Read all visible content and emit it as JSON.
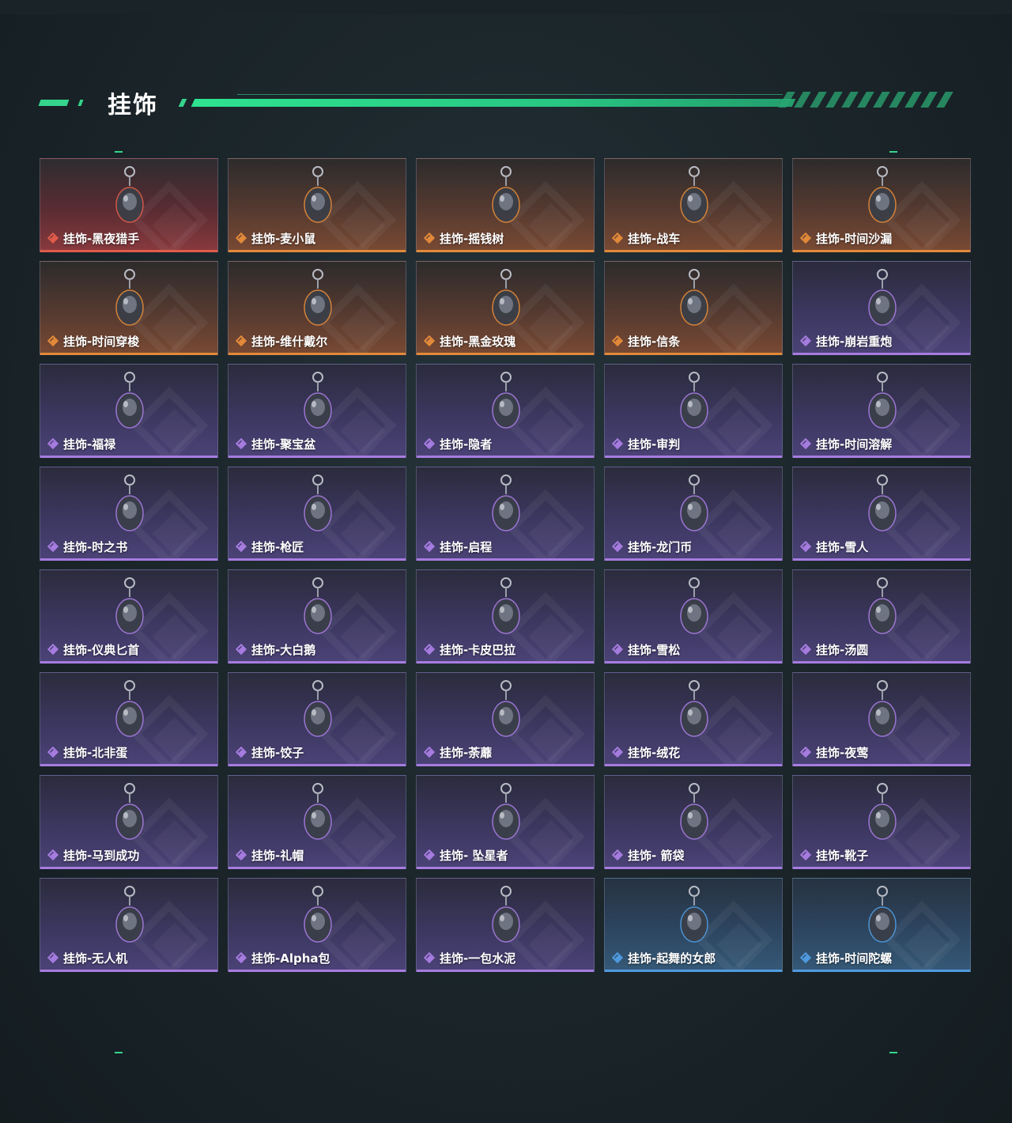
{
  "section": {
    "title": "挂饰"
  },
  "items": [
    {
      "label": "挂饰-黑夜猎手",
      "rarity": "red",
      "icon": "night-hunter-pendant-icon"
    },
    {
      "label": "挂饰-麦小鼠",
      "rarity": "orange",
      "icon": "mouse-pendant-icon"
    },
    {
      "label": "挂饰-摇钱树",
      "rarity": "orange",
      "icon": "money-tree-pendant-icon"
    },
    {
      "label": "挂饰-战车",
      "rarity": "orange",
      "icon": "chariot-card-pendant-icon"
    },
    {
      "label": "挂饰-时间沙漏",
      "rarity": "orange",
      "icon": "hourglass-pendant-icon"
    },
    {
      "label": "挂饰-时间穿梭",
      "rarity": "orange",
      "icon": "time-travel-pendant-icon"
    },
    {
      "label": "挂饰-维什戴尔",
      "rarity": "orange",
      "icon": "banner-pendant-icon"
    },
    {
      "label": "挂饰-黑金玫瑰",
      "rarity": "orange",
      "icon": "black-gold-rose-pendant-icon"
    },
    {
      "label": "挂饰-信条",
      "rarity": "orange",
      "icon": "creed-pendant-icon"
    },
    {
      "label": "挂饰-崩岩重炮",
      "rarity": "purple",
      "icon": "rock-cannon-pendant-icon"
    },
    {
      "label": "挂饰-福禄",
      "rarity": "purple",
      "icon": "gourd-pendant-icon"
    },
    {
      "label": "挂饰-聚宝盆",
      "rarity": "purple",
      "icon": "treasure-bowl-pendant-icon"
    },
    {
      "label": "挂饰-隐者",
      "rarity": "purple",
      "icon": "hermit-card-pendant-icon"
    },
    {
      "label": "挂饰-审判",
      "rarity": "purple",
      "icon": "judgement-card-pendant-icon"
    },
    {
      "label": "挂饰-时间溶解",
      "rarity": "purple",
      "icon": "melting-clock-pendant-icon"
    },
    {
      "label": "挂饰-时之书",
      "rarity": "purple",
      "icon": "book-pendant-icon"
    },
    {
      "label": "挂饰-枪匠",
      "rarity": "purple",
      "icon": "gunsmith-pendant-icon"
    },
    {
      "label": "挂饰-启程",
      "rarity": "purple",
      "icon": "departure-pendant-icon"
    },
    {
      "label": "挂饰-龙门币",
      "rarity": "purple",
      "icon": "coin-card-pendant-icon"
    },
    {
      "label": "挂饰-雪人",
      "rarity": "purple",
      "icon": "snowman-pendant-icon"
    },
    {
      "label": "挂饰-仪典匕首",
      "rarity": "purple",
      "icon": "dagger-pendant-icon"
    },
    {
      "label": "挂饰-大白鹅",
      "rarity": "purple",
      "icon": "goose-pendant-icon"
    },
    {
      "label": "挂饰-卡皮巴拉",
      "rarity": "purple",
      "icon": "capybara-pendant-icon"
    },
    {
      "label": "挂饰-雪松",
      "rarity": "purple",
      "icon": "pine-tree-pendant-icon"
    },
    {
      "label": "挂饰-汤圆",
      "rarity": "purple",
      "icon": "dumpling-bowl-pendant-icon"
    },
    {
      "label": "挂饰-北非蛋",
      "rarity": "purple",
      "icon": "shakshuka-pendant-icon"
    },
    {
      "label": "挂饰-饺子",
      "rarity": "purple",
      "icon": "dumplings-plate-pendant-icon"
    },
    {
      "label": "挂饰-荼蘼",
      "rarity": "purple",
      "icon": "flower-pendant-icon"
    },
    {
      "label": "挂饰-绒花",
      "rarity": "purple",
      "icon": "velvet-flower-pendant-icon"
    },
    {
      "label": "挂饰-夜莺",
      "rarity": "purple",
      "icon": "feather-pendant-icon"
    },
    {
      "label": "挂饰-马到成功",
      "rarity": "purple",
      "icon": "horse-pendant-icon"
    },
    {
      "label": "挂饰-礼帽",
      "rarity": "purple",
      "icon": "fedora-hat-pendant-icon"
    },
    {
      "label": "挂饰- 坠星者",
      "rarity": "purple",
      "icon": "triangle-emblem-pendant-icon"
    },
    {
      "label": "挂饰- 箭袋",
      "rarity": "purple",
      "icon": "quiver-pendant-icon"
    },
    {
      "label": "挂饰-靴子",
      "rarity": "purple",
      "icon": "boot-pendant-icon"
    },
    {
      "label": "挂饰-无人机",
      "rarity": "purple",
      "icon": "drone-pendant-icon"
    },
    {
      "label": "挂饰-Alpha包",
      "rarity": "purple",
      "icon": "alpha-bag-pendant-icon"
    },
    {
      "label": "挂饰-一包水泥",
      "rarity": "purple",
      "icon": "cement-bag-pendant-icon"
    },
    {
      "label": "挂饰-起舞的女郎",
      "rarity": "blue",
      "icon": "dancer-figurine-pendant-icon"
    },
    {
      "label": "挂饰-时间陀螺",
      "rarity": "blue",
      "icon": "spinning-top-pendant-icon"
    }
  ],
  "colors": {
    "accent": "#35d58c",
    "red": "#e05c4a",
    "orange": "#e28a3a",
    "purple": "#a77ce0",
    "blue": "#4f9be0"
  }
}
